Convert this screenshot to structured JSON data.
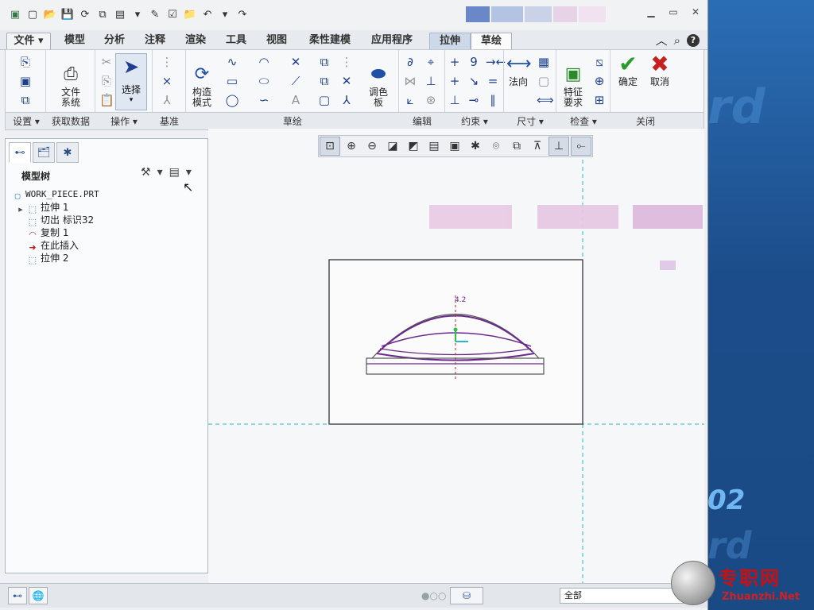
{
  "window": {
    "quick_access": [
      "新建",
      "打开",
      "保存",
      "再生",
      "窗口",
      "关闭"
    ],
    "controls": [
      "最小化",
      "最大化",
      "关闭"
    ]
  },
  "tabs": [
    {
      "label": "文件",
      "state": "file"
    },
    {
      "label": "模型"
    },
    {
      "label": "分析"
    },
    {
      "label": "注释"
    },
    {
      "label": "渲染"
    },
    {
      "label": "工具"
    },
    {
      "label": "视图"
    },
    {
      "label": "柔性建模"
    },
    {
      "label": "应用程序"
    },
    {
      "label": "拉伸",
      "state": "highlight"
    },
    {
      "label": "草绘",
      "state": "active"
    }
  ],
  "ribbon": {
    "file_system_label": "文件\n系统",
    "select_label": "选择",
    "construct_mode_label": "构造\n模式",
    "palette_label": "调色\n板",
    "normal_label": "法向",
    "feature_req_label": "特征\n要求",
    "ok_label": "确定",
    "cancel_label": "取消",
    "groups": {
      "settings": "设置",
      "get_data": "获取数据",
      "operations": "操作",
      "datum": "基准",
      "sketch": "草绘",
      "edit": "编辑",
      "constrain": "约束",
      "dimension": "尺寸",
      "inspect": "检查",
      "close": "关闭"
    }
  },
  "model_tree": {
    "header": "模型树",
    "items": [
      {
        "label": "WORK_PIECE.PRT",
        "icon": "part-icon"
      },
      {
        "label": "拉伸 1",
        "icon": "extrude-icon"
      },
      {
        "label": "切出 标识32",
        "icon": "cut-icon"
      },
      {
        "label": "复制 1",
        "icon": "copy-icon"
      },
      {
        "label": "在此插入",
        "icon": "insert-here-arrow-icon"
      },
      {
        "label": "拉伸 2",
        "icon": "extrude-icon"
      }
    ]
  },
  "sketch": {
    "dim_label": "4.2"
  },
  "status": {
    "filter_value": "全部"
  },
  "watermark": {
    "cn": "专职网",
    "en": "Zhuanzhi.Net"
  },
  "desktop_text": "02",
  "colors": {
    "ok": "#2a9a2a",
    "cancel": "#c62020",
    "sketch_purple": "#6a2a8c",
    "dashed_cyan": "#2bb6c8"
  }
}
